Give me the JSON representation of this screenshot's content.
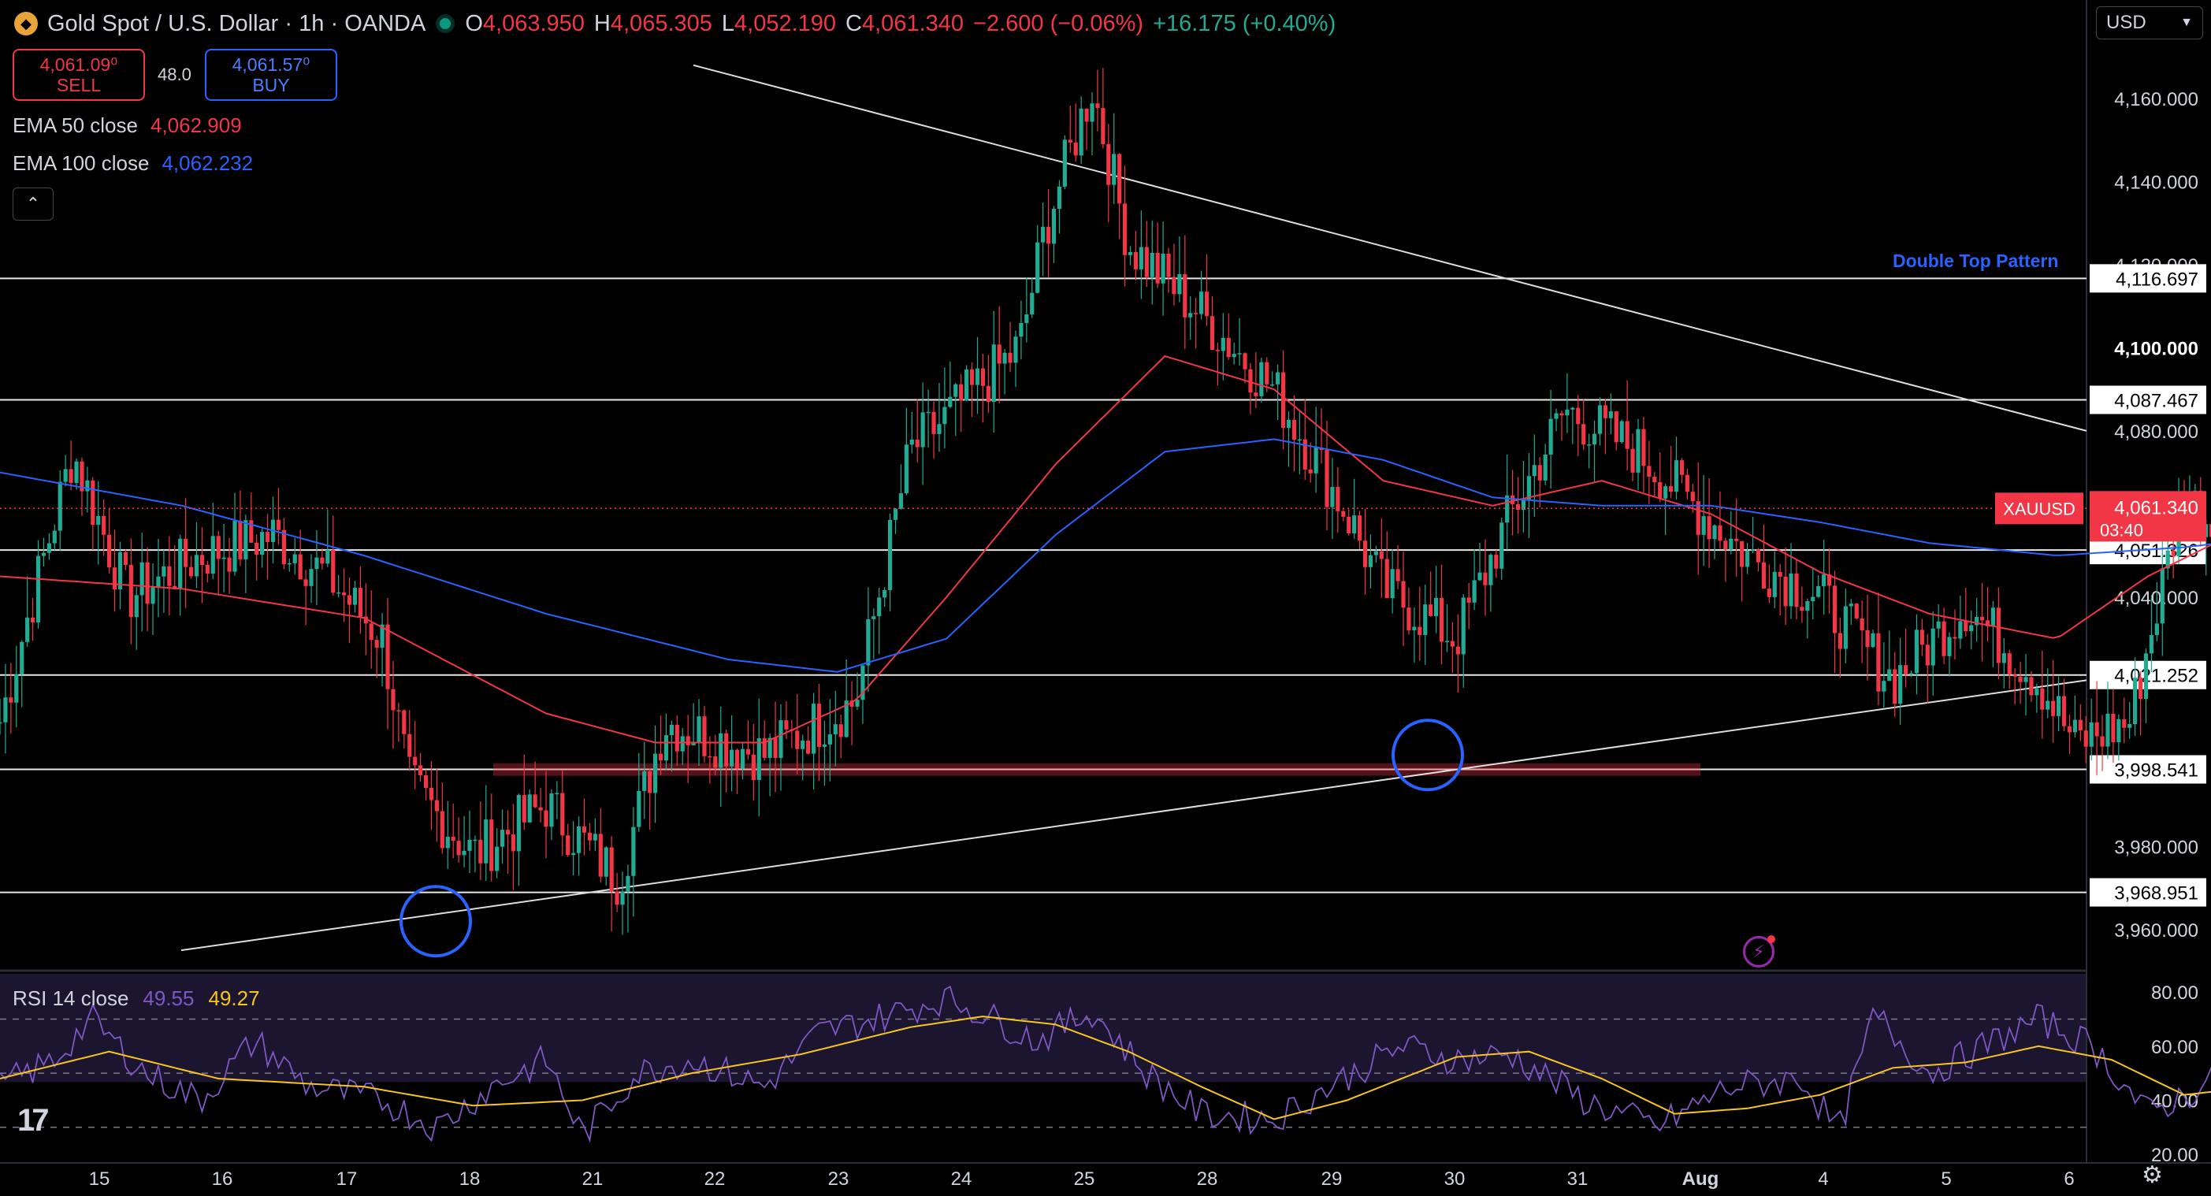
{
  "header": {
    "symbol": "Gold Spot / U.S. Dollar",
    "interval": "1h",
    "broker": "OANDA",
    "title_sep": "·",
    "o_label": "O",
    "o_value": "4,063.950",
    "h_label": "H",
    "h_value": "4,065.305",
    "l_label": "L",
    "l_value": "4,052.190",
    "c_label": "C",
    "c_value": "4,061.340",
    "change": "−2.600 (−0.06%)",
    "change2": "+16.175 (+0.40%)"
  },
  "trade": {
    "sell_price": "4,061.09⁰",
    "sell_label": "SELL",
    "spread": "48.0",
    "buy_price": "4,061.57⁰",
    "buy_label": "BUY"
  },
  "indicators": {
    "ema50_label": "EMA 50 close",
    "ema50_value": "4,062.909",
    "ema100_label": "EMA 100 close",
    "ema100_value": "4,062.232",
    "rsi_label": "RSI 14 close",
    "rsi_value": "49.55",
    "rsi_ma_value": "49.27"
  },
  "currency_select": {
    "value": "USD",
    "chevron": "chevron-down-icon"
  },
  "collapse_icon": "chevron-up-icon",
  "annotation": "Double Top Pattern",
  "price_tag": {
    "symbol": "XAUUSD",
    "price": "4,061.340",
    "countdown": "03:40"
  },
  "colors": {
    "bull": "#22ab94",
    "bear": "#f23645",
    "ema50": "#f23645",
    "ema100": "#2962ff",
    "rsi": "#7e57c2",
    "rsi_ma": "#f7c51d",
    "annotation": "#2962ff",
    "circle": "#2962ff"
  },
  "chart_data": {
    "type": "candlestick",
    "title": "Gold Spot / U.S. Dollar",
    "price_axis_ticks": [
      "4,160.000",
      "4,140.000",
      "4,120.000",
      "4,100.000",
      "4,080.000",
      "4,040.000",
      "3,980.000",
      "3,960.000"
    ],
    "horizontal_levels": [
      "4,116.697",
      "4,087.467",
      "4,051.326",
      "4,021.252",
      "3,998.541",
      "3,968.951"
    ],
    "horizontal_level_values": [
      4116.697,
      4087.467,
      4051.326,
      4021.252,
      3998.541,
      3968.951
    ],
    "x_tick_labels": [
      "15",
      "16",
      "17",
      "18",
      "21",
      "22",
      "23",
      "24",
      "25",
      "28",
      "29",
      "30",
      "31",
      "Aug",
      "4",
      "5",
      "6"
    ],
    "price_range": [
      3952,
      4178
    ],
    "rsi_ticks": [
      "80.00",
      "60.00",
      "40.00",
      "20.00"
    ],
    "rsi_range": [
      18,
      85
    ],
    "rsi_levels": [
      70,
      50,
      30
    ],
    "trendlines": [
      {
        "name": "descending",
        "from": {
          "date": "22",
          "price": 4168
        },
        "to": {
          "date": "6",
          "price": 4080
        }
      },
      {
        "name": "ascending",
        "from": {
          "date": "15",
          "price": 3955
        },
        "to": {
          "date": "6",
          "price": 4020
        }
      }
    ],
    "support_zone": {
      "from": "18",
      "to": "Aug",
      "price_low": 3997,
      "price_high": 4000
    },
    "highlight_circles": [
      {
        "date": "17",
        "price": 3962
      },
      {
        "date": "29",
        "price": 4002
      }
    ],
    "price_waypoints": [
      [
        0,
        4010
      ],
      [
        15,
        4035
      ],
      [
        40,
        4075
      ],
      [
        70,
        4040
      ],
      [
        110,
        4050
      ],
      [
        150,
        4055
      ],
      [
        180,
        4045
      ],
      [
        210,
        4030
      ],
      [
        225,
        3995
      ],
      [
        260,
        3978
      ],
      [
        300,
        3990
      ],
      [
        340,
        3972
      ],
      [
        365,
        4010
      ],
      [
        420,
        4002
      ],
      [
        470,
        4015
      ],
      [
        500,
        4075
      ],
      [
        560,
        4100
      ],
      [
        575,
        4130
      ],
      [
        600,
        4163
      ],
      [
        620,
        4125
      ],
      [
        660,
        4108
      ],
      [
        700,
        4090
      ],
      [
        740,
        4060
      ],
      [
        760,
        4042
      ],
      [
        800,
        4030
      ],
      [
        830,
        4060
      ],
      [
        860,
        4085
      ],
      [
        900,
        4075
      ],
      [
        960,
        4050
      ],
      [
        1000,
        4040
      ],
      [
        1040,
        4020
      ],
      [
        1080,
        4038
      ],
      [
        1120,
        4020
      ],
      [
        1140,
        4005
      ],
      [
        1170,
        4010
      ],
      [
        1200,
        4065
      ],
      [
        1230,
        4050
      ],
      [
        1260,
        4070
      ],
      [
        1300,
        4090
      ],
      [
        1320,
        4110
      ],
      [
        1360,
        4095
      ],
      [
        1380,
        4070
      ],
      [
        1400,
        4062
      ],
      [
        1420,
        4042
      ],
      [
        1440,
        4030
      ],
      [
        1460,
        4045
      ],
      [
        1480,
        4050
      ],
      [
        1520,
        4062
      ],
      [
        1545,
        4060
      ]
    ],
    "ema50_waypoints": [
      [
        0,
        4045
      ],
      [
        100,
        4042
      ],
      [
        200,
        4035
      ],
      [
        300,
        4012
      ],
      [
        360,
        4005
      ],
      [
        420,
        4005
      ],
      [
        470,
        4015
      ],
      [
        520,
        4040
      ],
      [
        580,
        4072
      ],
      [
        640,
        4098
      ],
      [
        700,
        4090
      ],
      [
        760,
        4068
      ],
      [
        820,
        4062
      ],
      [
        880,
        4068
      ],
      [
        940,
        4060
      ],
      [
        1000,
        4046
      ],
      [
        1060,
        4036
      ],
      [
        1130,
        4030
      ],
      [
        1180,
        4045
      ],
      [
        1240,
        4058
      ],
      [
        1300,
        4068
      ],
      [
        1360,
        4072
      ],
      [
        1420,
        4066
      ],
      [
        1480,
        4062
      ],
      [
        1545,
        4063
      ]
    ],
    "ema100_waypoints": [
      [
        0,
        4070
      ],
      [
        100,
        4062
      ],
      [
        200,
        4050
      ],
      [
        300,
        4036
      ],
      [
        400,
        4025
      ],
      [
        460,
        4022
      ],
      [
        520,
        4030
      ],
      [
        580,
        4055
      ],
      [
        640,
        4075
      ],
      [
        700,
        4078
      ],
      [
        760,
        4073
      ],
      [
        820,
        4064
      ],
      [
        880,
        4062
      ],
      [
        940,
        4062
      ],
      [
        1000,
        4058
      ],
      [
        1060,
        4053
      ],
      [
        1130,
        4050
      ],
      [
        1200,
        4052
      ],
      [
        1260,
        4055
      ],
      [
        1320,
        4064
      ],
      [
        1380,
        4066
      ],
      [
        1440,
        4063
      ],
      [
        1545,
        4062
      ]
    ],
    "rsi_waypoints": [
      [
        0,
        45
      ],
      [
        30,
        55
      ],
      [
        50,
        70
      ],
      [
        80,
        50
      ],
      [
        110,
        40
      ],
      [
        140,
        62
      ],
      [
        170,
        45
      ],
      [
        210,
        40
      ],
      [
        240,
        30
      ],
      [
        270,
        45
      ],
      [
        300,
        55
      ],
      [
        320,
        27
      ],
      [
        350,
        50
      ],
      [
        380,
        55
      ],
      [
        420,
        45
      ],
      [
        450,
        65
      ],
      [
        480,
        70
      ],
      [
        520,
        78
      ],
      [
        540,
        72
      ],
      [
        570,
        62
      ],
      [
        600,
        73
      ],
      [
        630,
        50
      ],
      [
        660,
        35
      ],
      [
        700,
        33
      ],
      [
        730,
        45
      ],
      [
        770,
        60
      ],
      [
        800,
        55
      ],
      [
        830,
        57
      ],
      [
        870,
        40
      ],
      [
        910,
        30
      ],
      [
        950,
        45
      ],
      [
        990,
        48
      ],
      [
        1010,
        28
      ],
      [
        1030,
        72
      ],
      [
        1060,
        50
      ],
      [
        1090,
        60
      ],
      [
        1120,
        70
      ],
      [
        1150,
        60
      ],
      [
        1180,
        35
      ],
      [
        1210,
        45
      ],
      [
        1240,
        55
      ],
      [
        1260,
        50
      ]
    ],
    "rsi_ma_waypoints": [
      [
        0,
        48
      ],
      [
        60,
        58
      ],
      [
        120,
        48
      ],
      [
        200,
        45
      ],
      [
        260,
        38
      ],
      [
        320,
        40
      ],
      [
        380,
        50
      ],
      [
        440,
        57
      ],
      [
        500,
        67
      ],
      [
        540,
        71
      ],
      [
        580,
        68
      ],
      [
        620,
        58
      ],
      [
        660,
        45
      ],
      [
        700,
        33
      ],
      [
        740,
        40
      ],
      [
        800,
        56
      ],
      [
        840,
        58
      ],
      [
        880,
        48
      ],
      [
        920,
        35
      ],
      [
        960,
        37
      ],
      [
        1000,
        42
      ],
      [
        1040,
        52
      ],
      [
        1080,
        54
      ],
      [
        1120,
        60
      ],
      [
        1160,
        55
      ],
      [
        1200,
        42
      ],
      [
        1240,
        45
      ],
      [
        1260,
        50
      ]
    ],
    "series": [
      {
        "name": "EMA 50 close",
        "last": 4062.909
      },
      {
        "name": "EMA 100 close",
        "last": 4062.232
      },
      {
        "name": "RSI 14 close",
        "last": 49.55
      }
    ]
  }
}
